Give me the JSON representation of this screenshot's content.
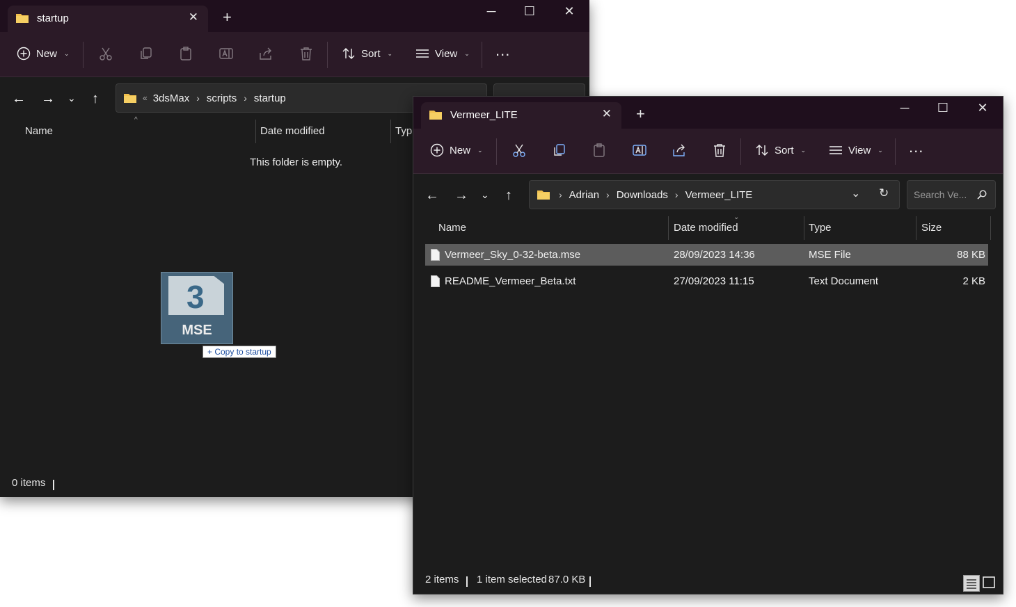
{
  "window1": {
    "tab_title": "startup",
    "toolbar": {
      "new": "New",
      "sort": "Sort",
      "view": "View",
      "more": "..."
    },
    "breadcrumb": {
      "overflow": "«",
      "items": [
        "3dsMax",
        "scripts",
        "startup"
      ]
    },
    "columns": {
      "name": "Name",
      "date": "Date modified",
      "type": "Typ"
    },
    "empty_text": "This folder is empty.",
    "status": "0 items",
    "drag": {
      "icon_number": "3",
      "icon_label": "MSE",
      "tooltip": "+ Copy to startup"
    }
  },
  "window2": {
    "tab_title": "Vermeer_LITE",
    "toolbar": {
      "new": "New",
      "sort": "Sort",
      "view": "View",
      "more": "..."
    },
    "breadcrumb": {
      "items": [
        "Adrian",
        "Downloads",
        "Vermeer_LITE"
      ]
    },
    "search_placeholder": "Search Ve...",
    "columns": {
      "name": "Name",
      "date": "Date modified",
      "type": "Type",
      "size": "Size"
    },
    "files": [
      {
        "name": "Vermeer_Sky_0-32-beta.mse",
        "date": "28/09/2023 14:36",
        "type": "MSE File",
        "size": "88 KB",
        "selected": true
      },
      {
        "name": "README_Vermeer_Beta.txt",
        "date": "27/09/2023 11:15",
        "type": "Text Document",
        "size": "2 KB",
        "selected": false
      }
    ],
    "status": {
      "count": "2 items",
      "selection": "1 item selected",
      "size": "87.0 KB"
    }
  },
  "colors": {
    "titlebar": "#1f0f1d",
    "toolbar": "#2b1a27",
    "content": "#1c1c1c",
    "folder": "#f2c14e",
    "selection": "#5c5c5c"
  },
  "icons": [
    "folder-icon",
    "close-icon",
    "plus-icon",
    "minimize-icon",
    "maximize-icon",
    "cut-icon",
    "copy-icon",
    "paste-icon",
    "rename-icon",
    "share-icon",
    "delete-icon",
    "sort-icon",
    "view-icon",
    "back-icon",
    "forward-icon",
    "up-icon",
    "refresh-icon",
    "search-icon",
    "file-icon"
  ]
}
